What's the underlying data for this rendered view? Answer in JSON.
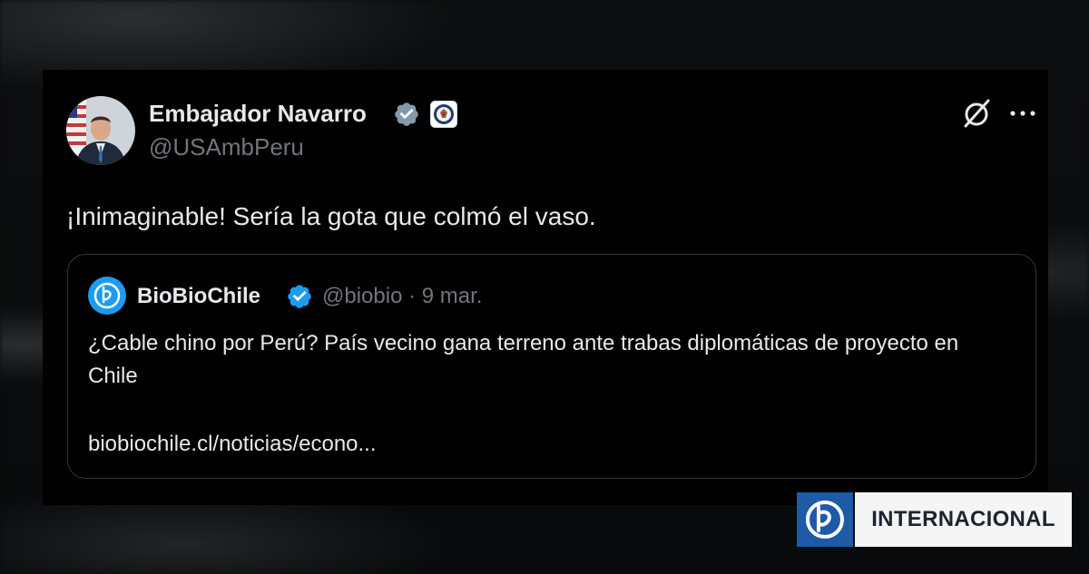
{
  "tweet": {
    "author_name": "Embajador Navarro",
    "author_handle": "@USAmbPeru",
    "text": "¡Inimaginable! Sería la gota que colmó el vaso."
  },
  "quoted_tweet": {
    "author_name": "BioBioChile",
    "author_handle": "@biobio",
    "separator": "·",
    "date": "9 mar.",
    "text": "¿Cable chino por Perú? País vecino gana terreno ante trabas diplomáticas de proyecto en Chile",
    "link": "biobiochile.cl/noticias/econo..."
  },
  "section_badge": {
    "label": "INTERNACIONAL"
  },
  "icons": {
    "author_verified": "verified-gray-icon",
    "author_affiliation": "us-state-department-seal-icon",
    "grok": "grok-icon",
    "more": "more-options-icon",
    "quoted_verified": "verified-blue-icon",
    "brand_logo": "biobio-logo-icon"
  },
  "colors": {
    "background": "#000000",
    "text_primary": "#e7e9ea",
    "text_secondary": "#71767b",
    "verified_blue": "#1d9bf0",
    "verified_gray": "#829aab",
    "brand_blue": "#1e5aa8"
  }
}
